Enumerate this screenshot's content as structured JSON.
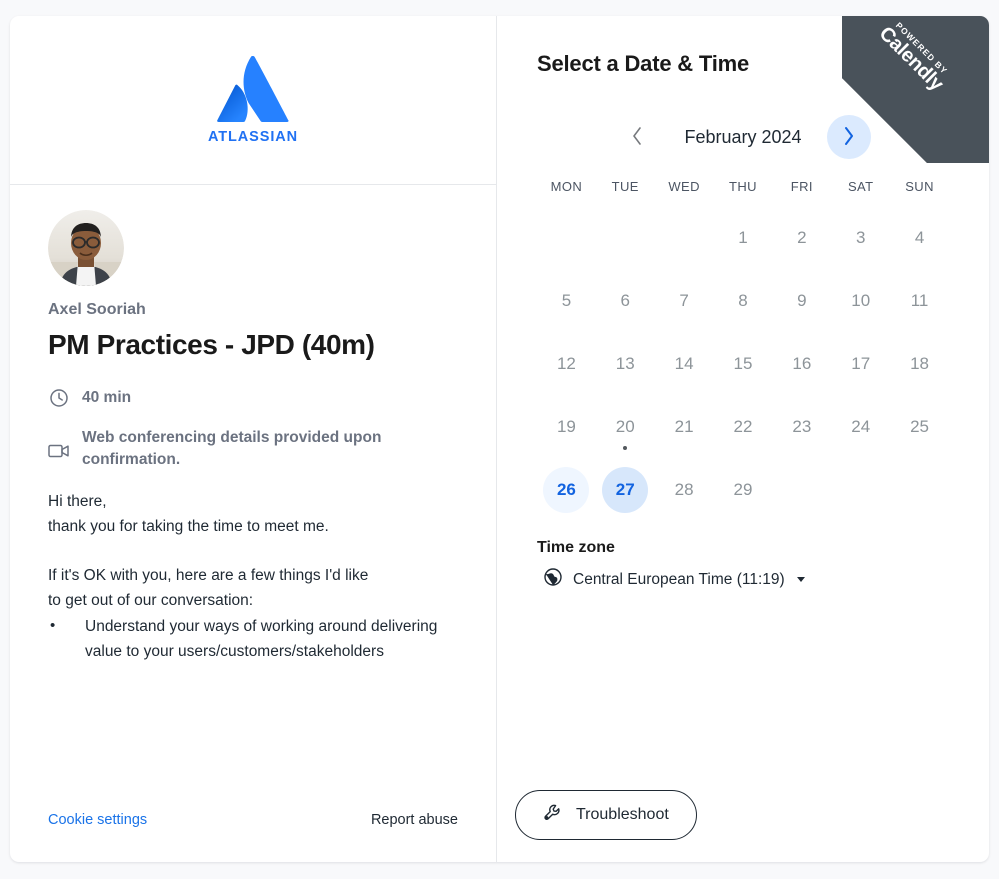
{
  "brand": {
    "logo_name": "atlassian-logo",
    "logo_wordmark": "ATLASSIAN",
    "logo_color": "#2071f3"
  },
  "ribbon": {
    "small_text": "POWERED BY",
    "big_text": "Calendly",
    "background": "#49525a"
  },
  "event": {
    "host_name": "Axel Sooriah",
    "title": "PM Practices - JPD (40m)",
    "duration": "40 min",
    "duration_icon": "clock-icon",
    "location": "Web conferencing details provided upon confirmation.",
    "location_icon": "video-camera-icon",
    "description": {
      "greeting": "Hi there,",
      "thanks": "thank you for taking the time to meet me.",
      "intro_line_1": "If it's OK with you, here are a few things I'd like",
      "intro_line_2": "to get out of our conversation:",
      "bullets": [
        "Understand your ways of working around delivering value to your users/customers/stakeholders"
      ]
    }
  },
  "footer": {
    "cookie_settings": "Cookie settings",
    "cookie_color": "#1a73e8",
    "report_abuse": "Report abuse"
  },
  "scheduler": {
    "title": "Select a Date & Time",
    "month_label": "February 2024",
    "prev_icon": "chevron-left-icon",
    "next_icon": "chevron-right-icon",
    "prev_enabled": false,
    "next_enabled": true,
    "weekdays": [
      "MON",
      "TUE",
      "WED",
      "THU",
      "FRI",
      "SAT",
      "SUN"
    ],
    "accent_color": "#1263e0",
    "available_bg": "#eff6ff",
    "hovered_bg": "#d7e7fb",
    "days": [
      {
        "label": "",
        "state": "empty"
      },
      {
        "label": "",
        "state": "empty"
      },
      {
        "label": "",
        "state": "empty"
      },
      {
        "label": "1",
        "state": "unavailable"
      },
      {
        "label": "2",
        "state": "unavailable"
      },
      {
        "label": "3",
        "state": "unavailable"
      },
      {
        "label": "4",
        "state": "unavailable"
      },
      {
        "label": "5",
        "state": "unavailable"
      },
      {
        "label": "6",
        "state": "unavailable"
      },
      {
        "label": "7",
        "state": "unavailable"
      },
      {
        "label": "8",
        "state": "unavailable"
      },
      {
        "label": "9",
        "state": "unavailable"
      },
      {
        "label": "10",
        "state": "unavailable"
      },
      {
        "label": "11",
        "state": "unavailable"
      },
      {
        "label": "12",
        "state": "unavailable"
      },
      {
        "label": "13",
        "state": "unavailable"
      },
      {
        "label": "14",
        "state": "unavailable"
      },
      {
        "label": "15",
        "state": "unavailable"
      },
      {
        "label": "16",
        "state": "unavailable"
      },
      {
        "label": "17",
        "state": "unavailable"
      },
      {
        "label": "18",
        "state": "unavailable"
      },
      {
        "label": "19",
        "state": "unavailable"
      },
      {
        "label": "20",
        "state": "unavailable",
        "today": true
      },
      {
        "label": "21",
        "state": "unavailable"
      },
      {
        "label": "22",
        "state": "unavailable"
      },
      {
        "label": "23",
        "state": "unavailable"
      },
      {
        "label": "24",
        "state": "unavailable"
      },
      {
        "label": "25",
        "state": "unavailable"
      },
      {
        "label": "26",
        "state": "available"
      },
      {
        "label": "27",
        "state": "available",
        "hovered": true
      },
      {
        "label": "28",
        "state": "unavailable"
      },
      {
        "label": "29",
        "state": "unavailable"
      },
      {
        "label": "",
        "state": "empty"
      },
      {
        "label": "",
        "state": "empty"
      },
      {
        "label": "",
        "state": "empty"
      }
    ],
    "timezone": {
      "heading": "Time zone",
      "icon": "globe-icon",
      "value": "Central European Time (11:19)"
    },
    "troubleshoot": {
      "label": "Troubleshoot",
      "icon": "wrench-icon"
    }
  }
}
